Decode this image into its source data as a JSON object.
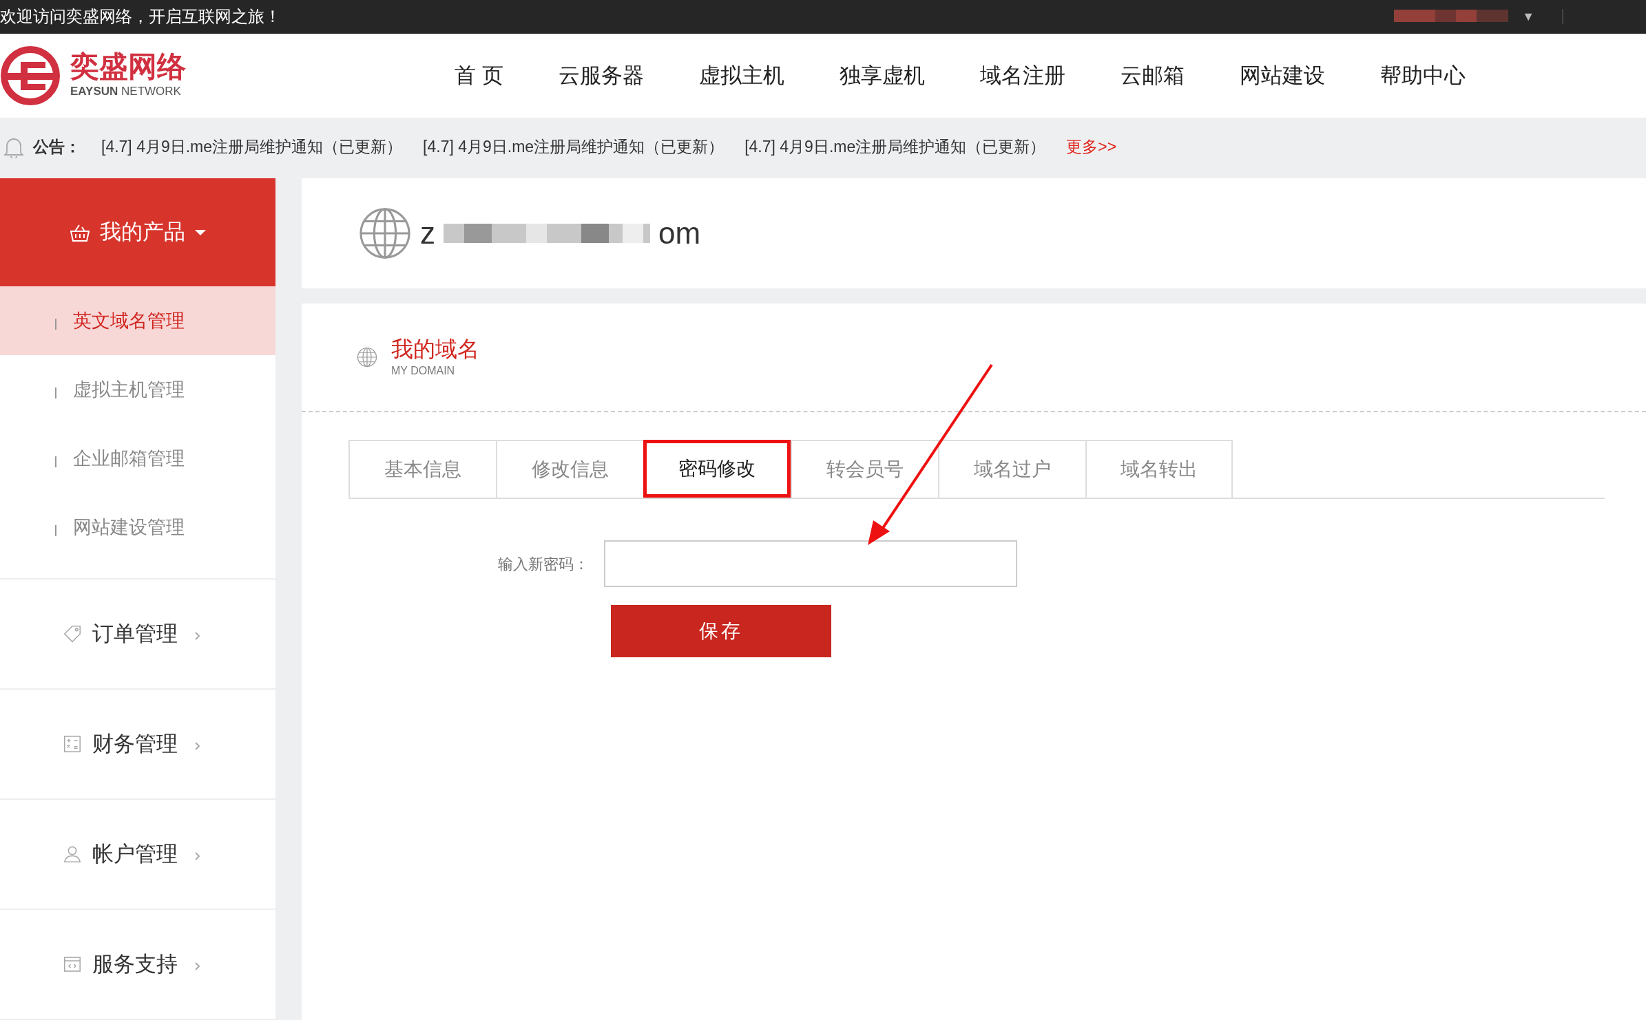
{
  "top_bar": {
    "welcome": "欢迎访问奕盛网络，开启互联网之旅！",
    "user_caret": "▼"
  },
  "header": {
    "logo_cn": "奕盛网络",
    "logo_en_bold": "EAYSUN",
    "logo_en": "NETWORK",
    "nav": [
      {
        "label": "首 页"
      },
      {
        "label": "云服务器"
      },
      {
        "label": "虚拟主机"
      },
      {
        "label": "独享虚机"
      },
      {
        "label": "域名注册"
      },
      {
        "label": "云邮箱"
      },
      {
        "label": "网站建设"
      },
      {
        "label": "帮助中心"
      }
    ]
  },
  "notice": {
    "label": "公告：",
    "items": [
      "[4.7] 4月9日.me注册局维护通知（已更新）",
      "[4.7] 4月9日.me注册局维护通知（已更新）",
      "[4.7] 4月9日.me注册局维护通知（已更新）"
    ],
    "more": "更多>>"
  },
  "sidebar": {
    "products": {
      "label": "我的产品",
      "expanded": true,
      "children": [
        {
          "label": "英文域名管理",
          "selected": true
        },
        {
          "label": "虚拟主机管理",
          "selected": false
        },
        {
          "label": "企业邮箱管理",
          "selected": false
        },
        {
          "label": "网站建设管理",
          "selected": false
        }
      ]
    },
    "sections": [
      {
        "label": "订单管理",
        "kind": "tag"
      },
      {
        "label": "财务管理",
        "kind": "calc"
      },
      {
        "label": "帐户管理",
        "kind": "user"
      },
      {
        "label": "服务支持",
        "kind": "code"
      }
    ]
  },
  "domain": {
    "start": "z",
    "end": "om"
  },
  "panel": {
    "title": "我的域名",
    "subtitle": "MY DOMAIN",
    "tabs": [
      {
        "label": "基本信息",
        "selected": false
      },
      {
        "label": "修改信息",
        "selected": false
      },
      {
        "label": "密码修改",
        "selected": true
      },
      {
        "label": "转会员号",
        "selected": false
      },
      {
        "label": "域名过户",
        "selected": false
      },
      {
        "label": "域名转出",
        "selected": false
      }
    ],
    "form": {
      "label": "输入新密码："
    },
    "save": "保存"
  }
}
